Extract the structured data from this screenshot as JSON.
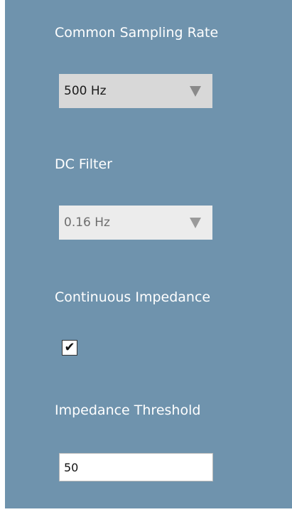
{
  "settings": {
    "sampling_rate": {
      "label": "Common Sampling Rate",
      "selected": "500 Hz",
      "arrow_icon": "triangle-down-icon"
    },
    "dc_filter": {
      "label": "DC Filter",
      "selected": "0.16 Hz",
      "arrow_icon": "triangle-down-icon"
    },
    "continuous_impedance": {
      "label": "Continuous Impedance",
      "checked": true,
      "check_glyph": "✔"
    },
    "impedance_threshold": {
      "label": "Impedance Threshold",
      "value": "50"
    }
  },
  "colors": {
    "panel_background": "#6f93ad",
    "label_text": "#ffffff"
  }
}
